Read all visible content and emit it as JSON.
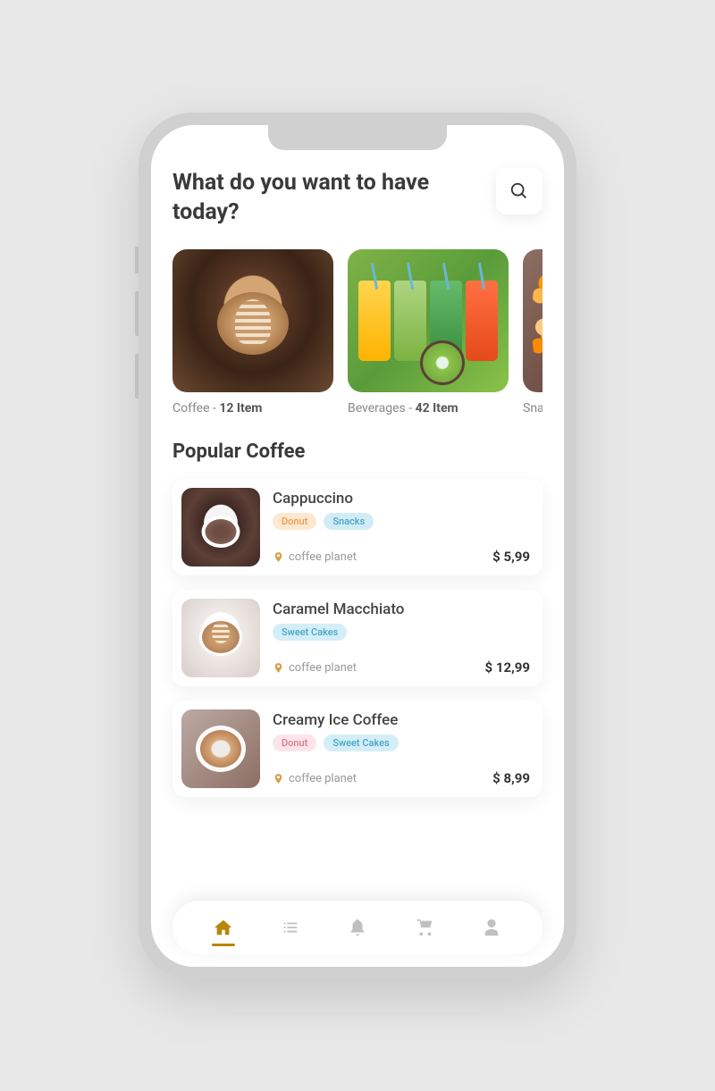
{
  "header": {
    "title": "What do you want to have today?"
  },
  "categories": [
    {
      "name": "Coffee",
      "count": "12 Item"
    },
    {
      "name": "Beverages",
      "count": "42 Item"
    },
    {
      "name": "Snack",
      "count": ""
    }
  ],
  "section": {
    "popular_title": "Popular Coffee"
  },
  "products": [
    {
      "name": "Cappuccino",
      "tags": [
        {
          "label": "Donut",
          "style": "orange"
        },
        {
          "label": "Snacks",
          "style": "blue"
        }
      ],
      "vendor": "coffee planet",
      "price": "$ 5,99"
    },
    {
      "name": "Caramel Macchiato",
      "tags": [
        {
          "label": "Sweet Cakes",
          "style": "blue2"
        }
      ],
      "vendor": "coffee planet",
      "price": "$ 12,99"
    },
    {
      "name": "Creamy Ice Coffee",
      "tags": [
        {
          "label": "Donut",
          "style": "pink"
        },
        {
          "label": "Sweet Cakes",
          "style": "blue2"
        }
      ],
      "vendor": "coffee planet",
      "price": "$ 8,99"
    }
  ],
  "nav": {
    "items": [
      "home",
      "list",
      "notifications",
      "cart",
      "profile"
    ],
    "active": "home"
  },
  "colors": {
    "accent": "#b8860b",
    "text_primary": "#3a3a3a",
    "text_secondary": "#888"
  }
}
